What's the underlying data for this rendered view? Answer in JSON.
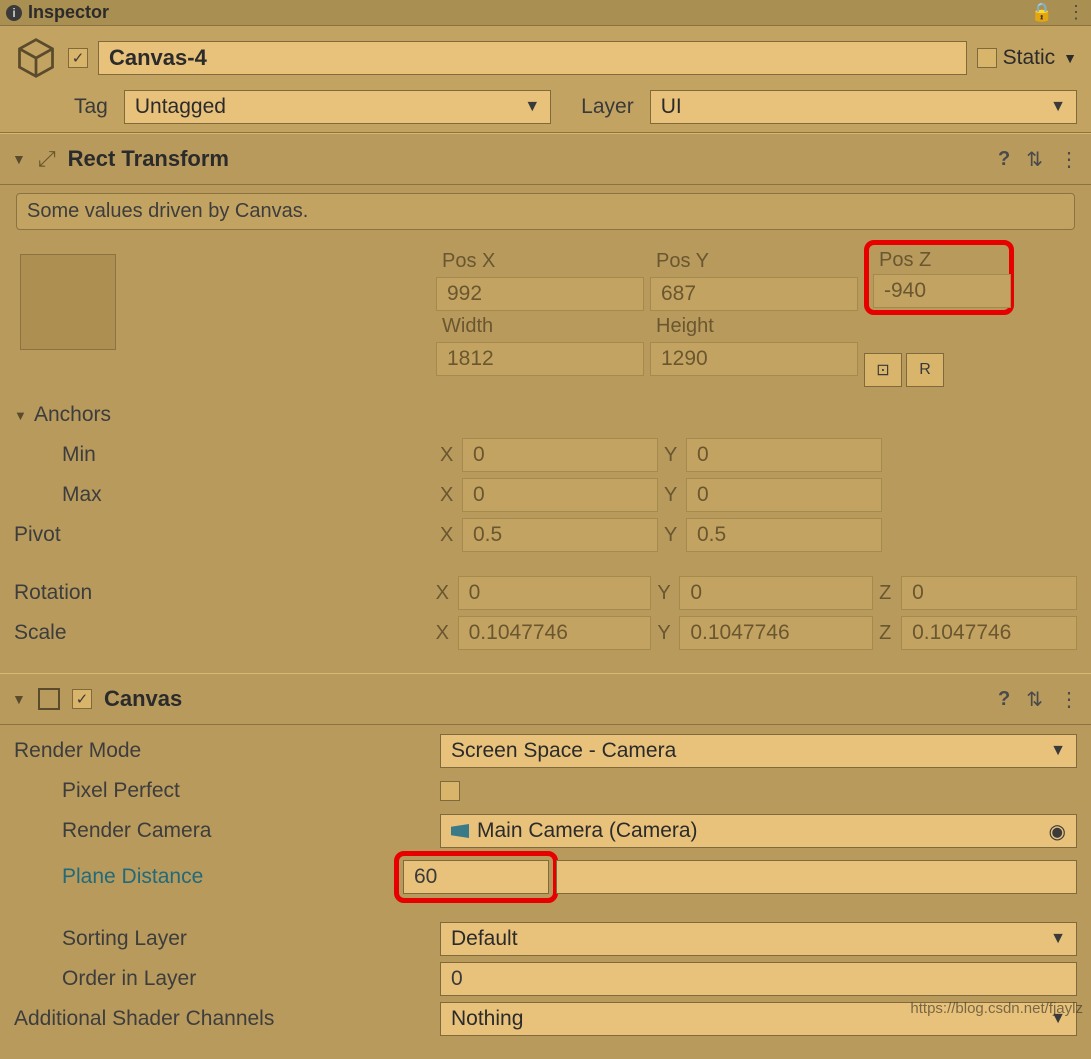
{
  "tab": {
    "title": "Inspector"
  },
  "header": {
    "name": "Canvas-4",
    "active_checked": "✓",
    "static_label": "Static",
    "tag_label": "Tag",
    "tag_value": "Untagged",
    "layer_label": "Layer",
    "layer_value": "UI"
  },
  "rect": {
    "title": "Rect Transform",
    "info": "Some values driven by Canvas.",
    "posx_label": "Pos X",
    "posx": "992",
    "posy_label": "Pos Y",
    "posy": "687",
    "posz_label": "Pos Z",
    "posz": "-940",
    "width_label": "Width",
    "width": "1812",
    "height_label": "Height",
    "height": "1290",
    "anchors_label": "Anchors",
    "min_label": "Min",
    "min_x": "0",
    "min_y": "0",
    "max_label": "Max",
    "max_x": "0",
    "max_y": "0",
    "pivot_label": "Pivot",
    "pivot_x": "0.5",
    "pivot_y": "0.5",
    "rotation_label": "Rotation",
    "rot_x": "0",
    "rot_y": "0",
    "rot_z": "0",
    "scale_label": "Scale",
    "scale_x": "0.1047746",
    "scale_y": "0.1047746",
    "scale_z": "0.1047746",
    "tool_blueprint": "⊡",
    "tool_raw": "R"
  },
  "canvas": {
    "title": "Canvas",
    "render_mode_label": "Render Mode",
    "render_mode_value": "Screen Space - Camera",
    "pixel_perfect_label": "Pixel Perfect",
    "render_camera_label": "Render Camera",
    "render_camera_value": "Main Camera (Camera)",
    "plane_distance_label": "Plane Distance",
    "plane_distance_value": "60",
    "sorting_layer_label": "Sorting Layer",
    "sorting_layer_value": "Default",
    "order_label": "Order in Layer",
    "order_value": "0",
    "shader_channels_label": "Additional Shader Channels",
    "shader_channels_value": "Nothing"
  },
  "letters": {
    "x": "X",
    "y": "Y",
    "z": "Z"
  },
  "watermark": "https://blog.csdn.net/fjaylz"
}
